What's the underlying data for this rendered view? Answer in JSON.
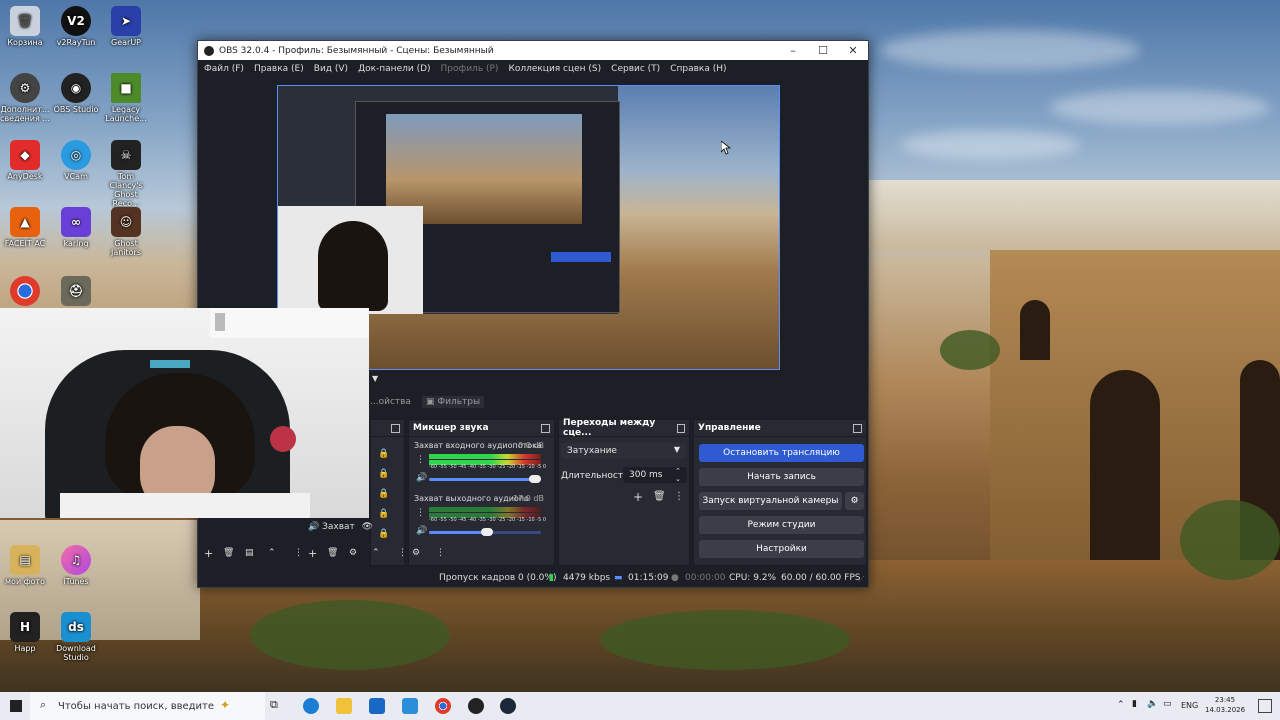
{
  "desktop": {
    "icons": [
      {
        "label": "Корзина"
      },
      {
        "label": "v2RayTun"
      },
      {
        "label": "GearUP"
      },
      {
        "label": "Дополнит... сведения ..."
      },
      {
        "label": "OBS Studio"
      },
      {
        "label": "Legacy Launche..."
      },
      {
        "label": "AnyDesk"
      },
      {
        "label": "VCam"
      },
      {
        "label": "Tom Clancy's Ghost Reco..."
      },
      {
        "label": "FACEIT AC"
      },
      {
        "label": "karing"
      },
      {
        "label": "Ghost Janitors"
      },
      {
        "label": "мои фото"
      },
      {
        "label": "iTunes"
      },
      {
        "label": "Happ"
      },
      {
        "label": "Download Studio"
      }
    ]
  },
  "obs": {
    "title": "OBS 32.0.4 - Профиль: Безымянный - Сцены: Безымянный",
    "menu": [
      "Файл (F)",
      "Правка (E)",
      "Вид (V)",
      "Док-панели (D)",
      "Профиль (P)",
      "Коллекция сцен (S)",
      "Сервис (T)",
      "Справка (H)"
    ],
    "tabs": {
      "properties": "...ойства",
      "filters": "Фильтры"
    },
    "source_label": "Захват",
    "mixer": {
      "title": "Микшер звука",
      "channels": [
        {
          "name": "Захват входного аудиопотока",
          "db": "0.0 dB",
          "scale": "-60 -55 -50 -45 -40 -35 -30 -25 -20 -15 -10 -5 0"
        },
        {
          "name": "Захват выходного аудиопо",
          "db": "-17.0 dB",
          "scale": "-60 -55 -50 -45 -40 -35 -30 -25 -20 -15 -10 -5 0"
        }
      ]
    },
    "transitions": {
      "title": "Переходы между сце...",
      "selected": "Затухание",
      "duration_label": "Длительность",
      "duration_value": "300 ms"
    },
    "controls": {
      "title": "Управление",
      "stop_stream": "Остановить трансляцию",
      "start_record": "Начать запись",
      "virtual_cam": "Запуск виртуальной камеры",
      "studio_mode": "Режим студии",
      "settings": "Настройки"
    },
    "status": {
      "dropped": "Пропуск кадров 0 (0.0%)",
      "bitrate": "4479 kbps",
      "stream_time": "01:15:09",
      "record_time": "00:00:00",
      "cpu": "CPU: 9.2%",
      "fps": "60.00 / 60.00 FPS"
    }
  },
  "taskbar": {
    "search_placeholder": "Чтобы начать поиск, введите",
    "lang": "ENG",
    "time": "23:45",
    "date": "14.03.2026"
  },
  "colors": {
    "accent": "#2f5bd2",
    "obs_bg": "#1d1f26",
    "dock_bg": "#272a33"
  }
}
